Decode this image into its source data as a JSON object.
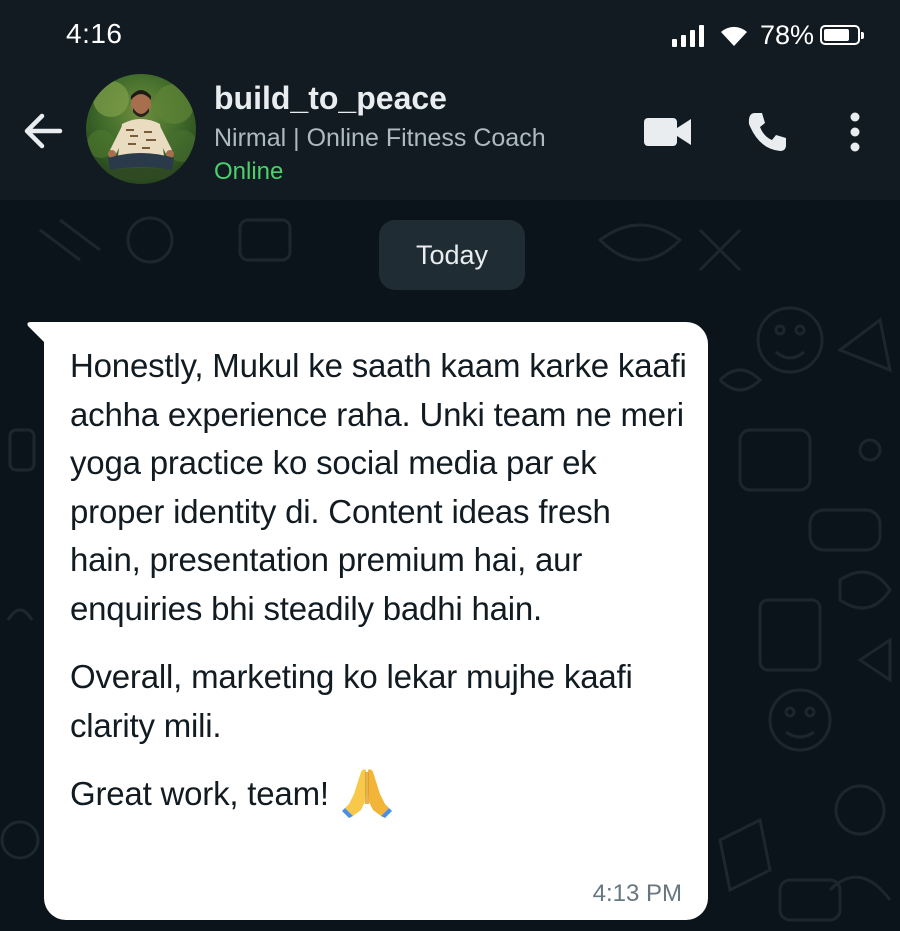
{
  "status_bar": {
    "time": "4:16",
    "battery_percent": "78%",
    "battery_level": 0.78,
    "icons": [
      "signal-icon",
      "wifi-icon",
      "battery-icon"
    ]
  },
  "header": {
    "contact_name": "build_to_peace",
    "subtitle": "Nirmal | Online Fitness Coach",
    "status": "Online",
    "icons": [
      "back-arrow-icon",
      "avatar",
      "video-call-icon",
      "voice-call-icon",
      "more-options-icon"
    ]
  },
  "chat": {
    "date_chip": "Today",
    "message": {
      "paragraphs": [
        "Honestly, Mukul ke saath kaam karke kaafi achha experience raha. Unki team ne meri yoga practice ko social media par ek proper identity di. Content ideas fresh hain, presentation premium hai, aur enquiries bhi steadily badhi hain.",
        "Overall, marketing ko lekar mujhe kaafi clarity mili.",
        "Great work, team!"
      ],
      "emoji": "folded-hands-icon",
      "time": "4:13 PM"
    }
  },
  "colors": {
    "header_bg": "#111b21",
    "chat_bg": "#0b141a",
    "bubble_bg": "#ffffff",
    "online_green": "#4cd06b",
    "date_chip_bg": "#1f2c33"
  }
}
